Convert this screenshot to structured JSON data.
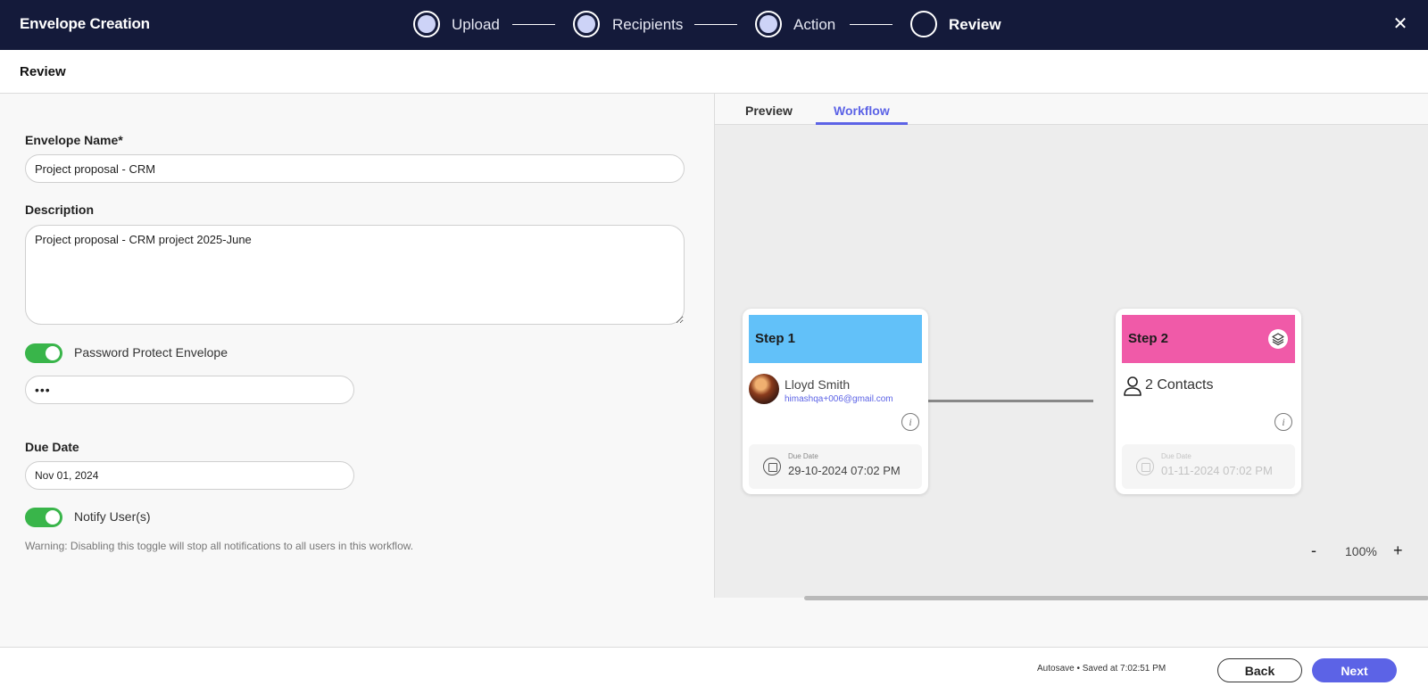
{
  "header": {
    "title": "Envelope Creation",
    "steps": [
      {
        "label": "Upload",
        "state": "complete"
      },
      {
        "label": "Recipients",
        "state": "complete"
      },
      {
        "label": "Action",
        "state": "complete"
      },
      {
        "label": "Review",
        "state": "current"
      }
    ],
    "close_icon": "close-icon"
  },
  "subheader": {
    "title": "Review"
  },
  "form": {
    "envelope_name_label": "Envelope Name*",
    "envelope_name_value": "Project proposal - CRM",
    "description_label": "Description",
    "description_value": "Project proposal - CRM project 2025-June",
    "password_toggle_label": "Password Protect Envelope",
    "password_toggle_on": true,
    "password_value": "•••",
    "due_date_label": "Due Date",
    "due_date_value": "Nov 01, 2024",
    "notify_toggle_label": "Notify User(s)",
    "notify_toggle_on": true,
    "warning": "Warning: Disabling this toggle will stop all notifications to all users in this workflow."
  },
  "workflow": {
    "tabs": [
      {
        "label": "Preview",
        "active": false
      },
      {
        "label": "Workflow",
        "active": true
      }
    ],
    "step1": {
      "title": "Step 1",
      "color": "#62c1f9",
      "name": "Lloyd Smith",
      "email": "himashqa+006@gmail.com",
      "due_caption": "Due Date",
      "due_value": "29-10-2024 07:02 PM"
    },
    "step2": {
      "title": "Step 2",
      "color": "#f05aa8",
      "contacts": "2 Contacts",
      "due_caption": "Due Date",
      "due_value": "01-11-2024 07:02 PM"
    },
    "zoom": {
      "minus": "-",
      "value": "100%",
      "plus": "+"
    }
  },
  "footer": {
    "autosave": "Autosave • Saved at 7:02:51 PM",
    "back_label": "Back",
    "next_label": "Next",
    "accent": "#5c63e6"
  }
}
